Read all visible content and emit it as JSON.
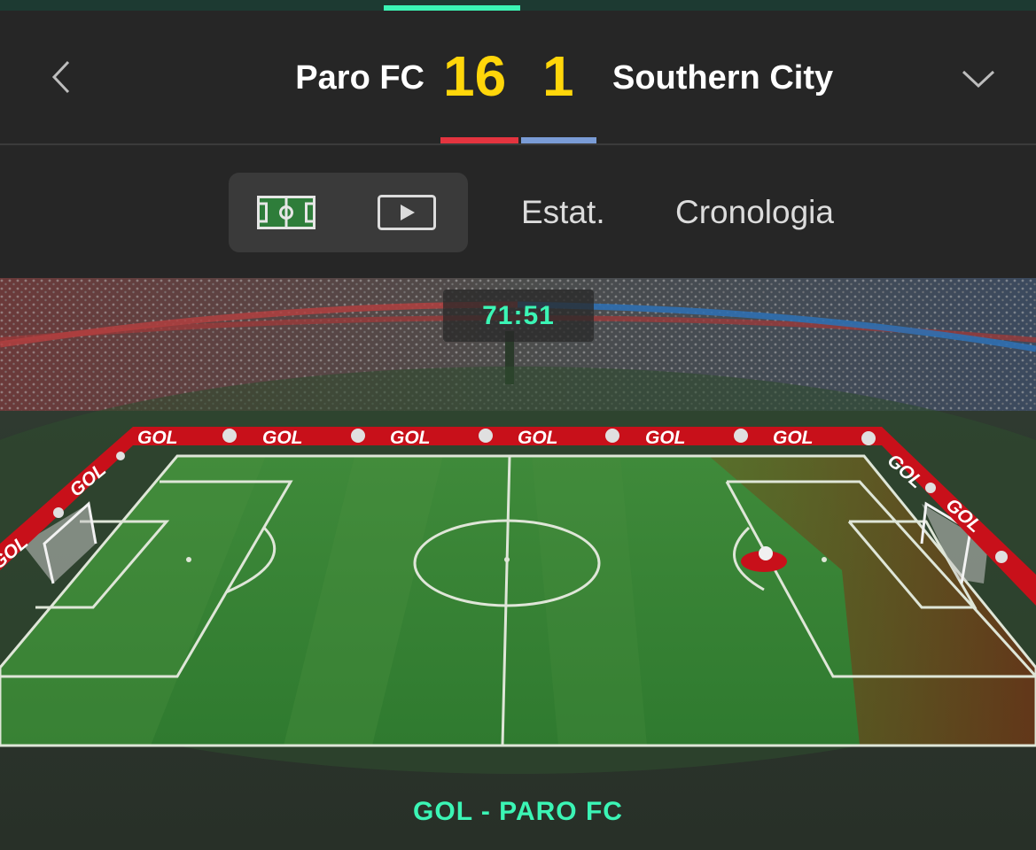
{
  "match": {
    "home_team": "Paro FC",
    "away_team": "Southern City",
    "home_score": "16",
    "away_score": "1",
    "home_color": "#e4343f",
    "away_color": "#7a9cd6",
    "score_color": "#ffd60a"
  },
  "nav": {
    "back_icon": "chevron-left-icon",
    "expand_icon": "chevron-down-icon"
  },
  "tabs": {
    "pitch_icon": "pitch-icon",
    "video_icon": "play-icon",
    "stats_label": "Estat.",
    "timeline_label": "Cronologia"
  },
  "live": {
    "clock": "71:51",
    "event_text": "GOL - PARO FC",
    "board_text": "GOL",
    "accent_color": "#3bf5b5"
  }
}
